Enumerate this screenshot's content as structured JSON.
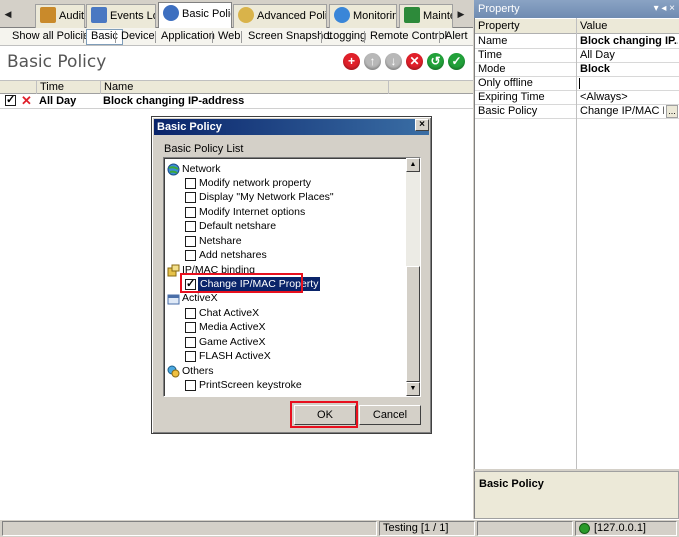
{
  "tabs": [
    {
      "label": "Audit",
      "icon": "audit-icon"
    },
    {
      "label": "Events Log",
      "icon": "events-log-icon"
    },
    {
      "label": "Basic Policy",
      "icon": "basic-policy-icon"
    },
    {
      "label": "Advanced Policy",
      "icon": "advanced-policy-icon"
    },
    {
      "label": "Monitoring",
      "icon": "monitoring-icon"
    },
    {
      "label": "Maintenance",
      "icon": "maintenance-icon"
    }
  ],
  "subtoolbar": [
    "Show all Policies",
    "Basic",
    "Device",
    "Application",
    "Web",
    "Screen Snapshot",
    "Logging",
    "Remote Control",
    "Alert"
  ],
  "panel_title": "Basic Policy",
  "action_buttons": [
    {
      "name": "add",
      "glyph": "+",
      "color": "#e0202a"
    },
    {
      "name": "move-up",
      "glyph": "↑",
      "color": "#b8b8b8"
    },
    {
      "name": "move-down",
      "glyph": "↓",
      "color": "#b8b8b8"
    },
    {
      "name": "delete",
      "glyph": "✕",
      "color": "#e0202a"
    },
    {
      "name": "undo",
      "glyph": "↺",
      "color": "#22a13a"
    },
    {
      "name": "apply",
      "glyph": "✓",
      "color": "#22a13a"
    }
  ],
  "grid": {
    "columns": [
      "Time",
      "Name"
    ],
    "rows": [
      {
        "checked": true,
        "status": "✕",
        "time": "All Day",
        "name": "Block changing IP-address"
      }
    ]
  },
  "dialog": {
    "title": "Basic Policy",
    "close_glyph": "×",
    "list_label": "Basic Policy List",
    "groups": [
      {
        "label": "Network",
        "items": [
          {
            "label": "Modify network property",
            "checked": false
          },
          {
            "label": "Display \"My Network Places\"",
            "checked": false
          },
          {
            "label": "Modify Internet options",
            "checked": false
          },
          {
            "label": "Default netshare",
            "checked": false
          },
          {
            "label": "Netshare",
            "checked": false
          },
          {
            "label": "Add netshares",
            "checked": false
          }
        ]
      },
      {
        "label": "IP/MAC binding",
        "items": [
          {
            "label": "Change IP/MAC Property",
            "checked": true,
            "selected": true
          }
        ]
      },
      {
        "label": "ActiveX",
        "items": [
          {
            "label": "Chat ActiveX",
            "checked": false
          },
          {
            "label": "Media ActiveX",
            "checked": false
          },
          {
            "label": "Game ActiveX",
            "checked": false
          },
          {
            "label": "FLASH ActiveX",
            "checked": false
          }
        ]
      },
      {
        "label": "Others",
        "items": [
          {
            "label": "PrintScreen keystroke",
            "checked": false
          }
        ]
      }
    ],
    "ok_label": "OK",
    "cancel_label": "Cancel"
  },
  "property_panel": {
    "title": "Property",
    "controls": "▾ ◂ ×",
    "columns": [
      "Property",
      "Value"
    ],
    "rows": [
      {
        "name": "Name",
        "value": "Block changing IP...",
        "bold": true
      },
      {
        "name": "Time",
        "value": "All Day",
        "bold": false
      },
      {
        "name": "Mode",
        "value": "Block",
        "bold": true
      },
      {
        "name": "Only offline",
        "value": "",
        "bold": false
      },
      {
        "name": "Expiring Time",
        "value": "<Always>",
        "bold": false
      },
      {
        "name": "Basic Policy",
        "value": "Change IP/MAC Prope",
        "bold": false
      }
    ],
    "ellipsis": "...",
    "description_title": "Basic Policy"
  },
  "statusbar": {
    "testing": "Testing [1 / 1]",
    "server": "[127.0.0.1]",
    "server_status_color": "#2a9a2a"
  },
  "colors": {
    "highlight": "#e8101e",
    "selection": "#0a246a"
  }
}
